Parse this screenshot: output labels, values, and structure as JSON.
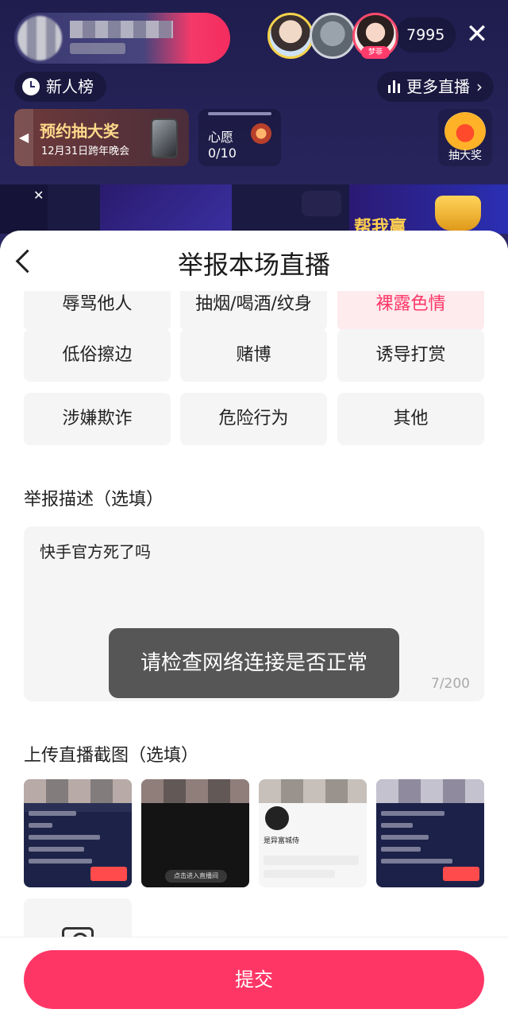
{
  "live": {
    "host": {
      "name_text": "",
      "sub_text": "",
      "viewer_badge": "梦菲"
    },
    "viewer_count": "7995",
    "rank_label": "新人榜",
    "more_live_label": "更多直播",
    "promo": {
      "title": "预约抽大奖",
      "subtitle": "12月31日跨年晚会"
    },
    "wish": {
      "label": "心愿",
      "count": "0/10"
    },
    "lottery_label": "抽大奖",
    "strip_right_text": "帮我赢"
  },
  "sheet": {
    "title": "举报本场直播",
    "reasons_partial": [
      "辱骂他人",
      "抽烟/喝酒/纹身",
      "裸露色情"
    ],
    "reasons": [
      "低俗擦边",
      "赌博",
      "诱导打赏",
      "涉嫌欺诈",
      "危险行为",
      "其他"
    ],
    "description": {
      "label": "举报描述（选填）",
      "value": "快手官方死了吗",
      "counter": "7/200"
    },
    "upload": {
      "label": "上传直播截图（选填）",
      "shot2_caption": "点击进入直播间",
      "shot3_name": "是异富城侍"
    },
    "submit_label": "提交"
  },
  "toast": "请检查网络连接是否正常",
  "colors": {
    "accent": "#fe3666",
    "sheet_bg": "#ffffff",
    "chip_bg": "#f5f5f5",
    "live_bg": "#1f1d4d"
  },
  "icons": [
    "close-icon",
    "clock-icon",
    "bars-icon",
    "chevron-right-icon",
    "back-chevron-icon",
    "camera-icon"
  ]
}
